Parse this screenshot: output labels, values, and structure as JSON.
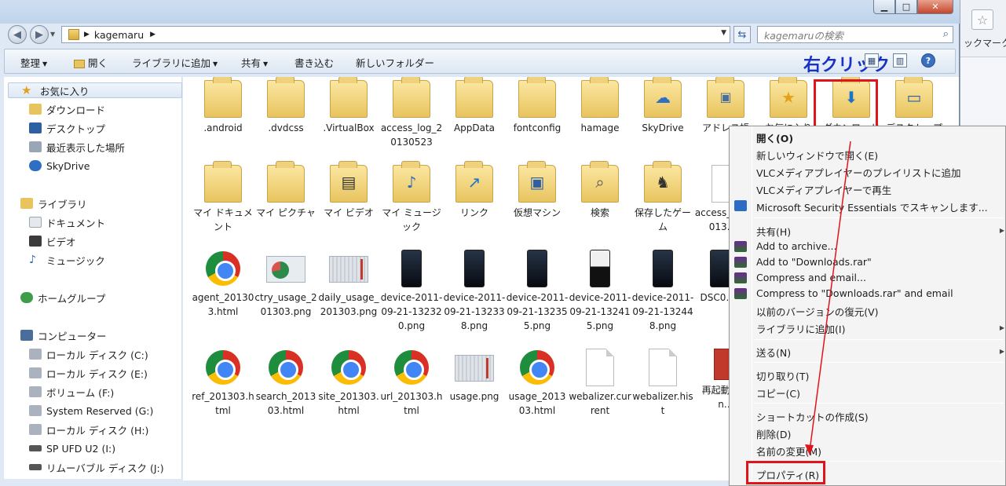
{
  "background_browser": {
    "bookmark_text": "ックマーク"
  },
  "address": {
    "crumb": "kagemaru"
  },
  "search": {
    "placeholder": "kagemaruの検索"
  },
  "toolbar": {
    "organize": "整理",
    "open": "開く",
    "add_to_library": "ライブラリに追加",
    "share": "共有",
    "burn": "書き込む",
    "new_folder": "新しいフォルダー",
    "annotation": "右クリック"
  },
  "sidebar": {
    "favorites_header": "お気に入り",
    "favorites": [
      "ダウンロード",
      "デスクトップ",
      "最近表示した場所",
      "SkyDrive"
    ],
    "libraries_header": "ライブラリ",
    "libraries": [
      "ドキュメント",
      "ビデオ",
      "ミュージック"
    ],
    "homegroup": "ホームグループ",
    "computer_header": "コンピューター",
    "drives": [
      "ローカル ディスク (C:)",
      "ローカル ディスク (E:)",
      "ボリューム (F:)",
      "System Reserved (G:)",
      "ローカル ディスク (H:)",
      "SP UFD U2 (I:)",
      "リムーバブル ディスク (J:)"
    ]
  },
  "files": {
    "row1": [
      ".android",
      ".dvdcss",
      ".VirtualBox",
      "access_log_20130523",
      "AppData",
      "fontconfig",
      "hamage",
      "SkyDrive",
      "アドレス帳",
      "お気に入り",
      "ダウンロード",
      "デスクトップ"
    ],
    "row2": [
      "マイ ドキュメント",
      "マイ ピクチャ",
      "マイ ビデオ",
      "マイ ミュージック",
      "リンク",
      "仮想マシン",
      "検索",
      "保存したゲーム",
      "access_log_2013…4"
    ],
    "row3": [
      "agent_201303.html",
      "ctry_usage_201303.png",
      "daily_usage_201303.png",
      "device-2011-09-21-132320.png",
      "device-2011-09-21-132338.png",
      "device-2011-09-21-132355.png",
      "device-2011-09-21-132415.png",
      "device-2011-09-21-132448.png",
      "DSC0…JPG"
    ],
    "row4": [
      "ref_201303.html",
      "search_201303.html",
      "site_201303.html",
      "url_201303.html",
      "usage.png",
      "usage_201303.html",
      "webalizer.current",
      "webalizer.hist",
      "再起動pspin…"
    ]
  },
  "context_menu": {
    "open": "開く(O)",
    "open_new_window": "新しいウィンドウで開く(E)",
    "vlc_playlist": "VLCメディアプレイヤーのプレイリストに追加",
    "vlc_play": "VLCメディアプレイヤーで再生",
    "mse_scan": "Microsoft Security Essentials でスキャンします...",
    "share": "共有(H)",
    "add_archive": "Add to archive...",
    "add_rar": "Add to \"Downloads.rar\"",
    "compress_email": "Compress and email...",
    "compress_rar_email": "Compress to \"Downloads.rar\" and email",
    "restore_prev": "以前のバージョンの復元(V)",
    "add_library": "ライブラリに追加(I)",
    "send_to": "送る(N)",
    "cut": "切り取り(T)",
    "copy": "コピー(C)",
    "create_shortcut": "ショートカットの作成(S)",
    "delete": "削除(D)",
    "rename": "名前の変更(M)",
    "properties": "プロパティ(R)"
  },
  "colors": {
    "annotation_blue": "#1731c9",
    "highlight_red": "#e0141b"
  }
}
